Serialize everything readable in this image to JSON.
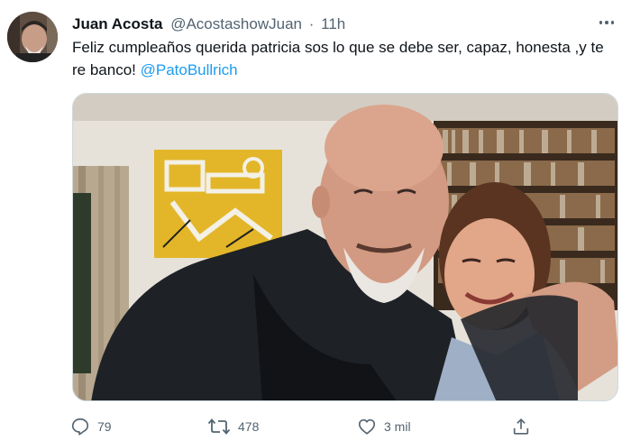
{
  "tweet": {
    "display_name": "Juan Acosta",
    "handle": "@AcostashowJuan",
    "separator": "·",
    "time": "11h",
    "text": "Feliz cumpleaños querida patricia sos lo que se debe ser, capaz, honesta ,y te re banco! ",
    "mention": "@PatoBullrich"
  },
  "avatar": {
    "icon": "avatar-photo"
  },
  "media": {
    "icon": "photo-two-people-with-bookshelf-and-yellow-painting"
  },
  "actions": {
    "reply_count": "79",
    "retweet_count": "478",
    "like_count": "3 mil"
  },
  "colors": {
    "link": "#1d9bf0",
    "secondary_text": "#536471",
    "primary_text": "#0f1419"
  }
}
